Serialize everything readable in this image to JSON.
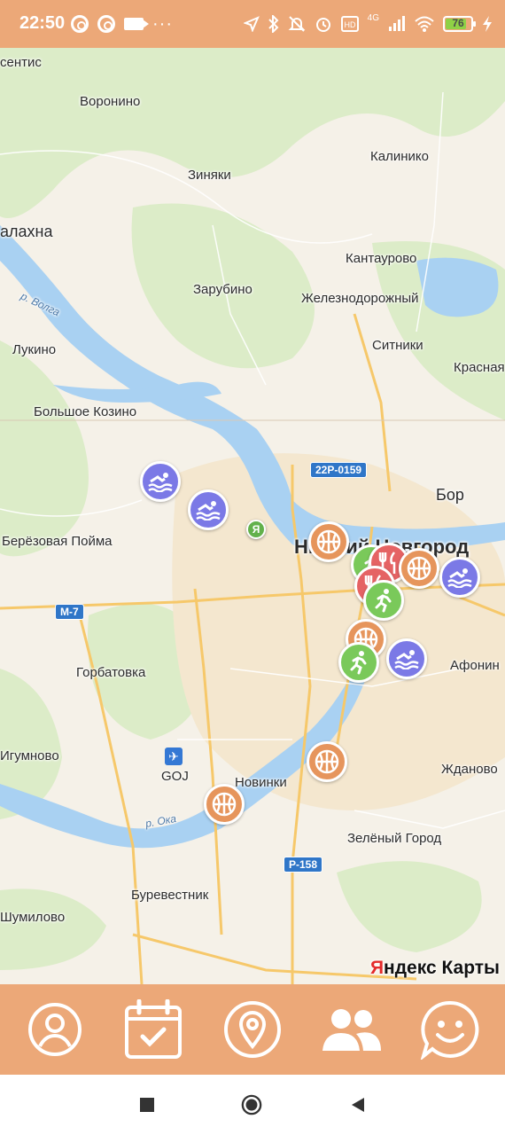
{
  "status_bar": {
    "time": "22:50",
    "battery_level": "76",
    "network": "4G",
    "icons": [
      "ring-icon",
      "ring-icon",
      "video-camera-icon",
      "more-dots-icon",
      "location-arrow-icon",
      "bluetooth-icon",
      "mute-bell-icon",
      "alarm-icon",
      "volte-icon",
      "signal-icon",
      "wifi-icon",
      "battery-icon",
      "charging-icon"
    ]
  },
  "map": {
    "places": [
      {
        "name": "сентис"
      },
      {
        "name": "Воронино"
      },
      {
        "name": "Зиняки"
      },
      {
        "name": "Калинико"
      },
      {
        "name": "алахна"
      },
      {
        "name": "Кантаурово"
      },
      {
        "name": "Зарубино"
      },
      {
        "name": "Железнодорожный"
      },
      {
        "name": "Лукино"
      },
      {
        "name": "Ситники"
      },
      {
        "name": "Красная"
      },
      {
        "name": "Большое Козино"
      },
      {
        "name": "Бор"
      },
      {
        "name": "Берёзовая Пойма"
      },
      {
        "name": "Нижний Новгород"
      },
      {
        "name": "Горбатовка"
      },
      {
        "name": "Афонин"
      },
      {
        "name": "Игумново"
      },
      {
        "name": "GOJ"
      },
      {
        "name": "Новинки"
      },
      {
        "name": "Жданово"
      },
      {
        "name": "Зелёный Город"
      },
      {
        "name": "Буревестник"
      },
      {
        "name": "Шумилово"
      }
    ],
    "rivers": [
      "р. Волга",
      "р. Ока"
    ],
    "road_badges": [
      "22Р-0159",
      "М-7",
      "Р-158"
    ],
    "user_location_label": "Я",
    "brand_first": "Я",
    "brand_rest": "ндекс Карты",
    "colors": {
      "basketball": "#e6955c",
      "swimming": "#7b79e6",
      "running": "#7ac95a",
      "food": "#e56364"
    }
  },
  "bottom_nav": {
    "items": [
      {
        "icon": "profile-icon"
      },
      {
        "icon": "calendar-icon"
      },
      {
        "icon": "location-pin-icon"
      },
      {
        "icon": "people-icon"
      },
      {
        "icon": "chat-smile-icon"
      }
    ],
    "background": "#eca878"
  },
  "system_nav": {
    "icons": [
      "recents-square-icon",
      "home-circle-icon",
      "back-triangle-icon"
    ]
  }
}
